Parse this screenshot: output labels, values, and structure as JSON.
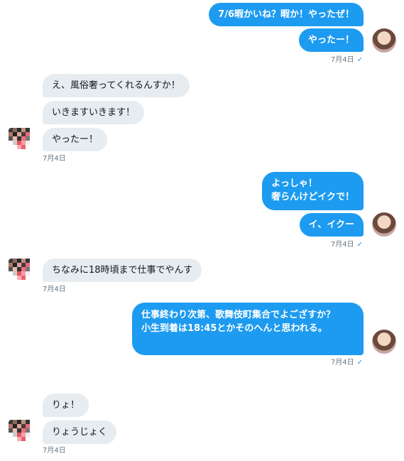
{
  "colors": {
    "outgoing_bubble": "#1d9bf0",
    "incoming_bubble": "#e6ecf0",
    "check": "#1d9bf0"
  },
  "messages": [
    {
      "from": "me",
      "text": "7/6暇かいね？暇か！やったぜ！"
    },
    {
      "from": "me",
      "text": "やったー！"
    },
    {
      "from": "me",
      "time": "7月4日"
    },
    {
      "from": "them",
      "text": "え、風俗奢ってくれるんすか！"
    },
    {
      "from": "them",
      "text": "いきますいきます！"
    },
    {
      "from": "them",
      "text": "やったー！"
    },
    {
      "from": "them",
      "time": "7月4日"
    },
    {
      "from": "me",
      "text": "よっしゃ！\n奢らんけどイクで！"
    },
    {
      "from": "me",
      "text": "イ、イクー"
    },
    {
      "from": "me",
      "time": "7月4日"
    },
    {
      "from": "them",
      "text": "ちなみに18時頃まで仕事でやんす"
    },
    {
      "from": "them",
      "time": "7月4日"
    },
    {
      "from": "me",
      "text": "仕事終わり次第、歌舞伎町集合でよござすか？\n小生到着は18:45とかそのへんと思われる。"
    },
    {
      "from": "me",
      "time": "7月4日"
    },
    {
      "from": "them",
      "text": "りょ！"
    },
    {
      "from": "them",
      "text": "りょうじょく"
    },
    {
      "from": "them",
      "time": "7月4日"
    }
  ],
  "icons": {
    "read_receipt": "✓",
    "self_avatar": "avatar-icon",
    "other_avatar": "pixelated-avatar-icon"
  }
}
